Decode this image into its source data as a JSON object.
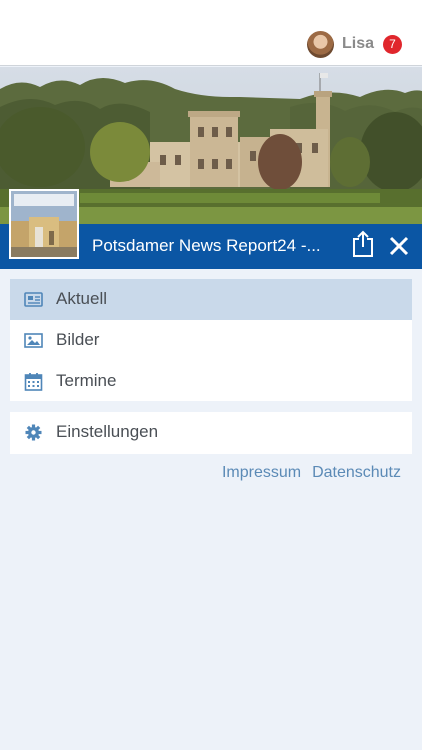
{
  "user": {
    "name": "Lisa",
    "notifications": "7"
  },
  "header": {
    "title": "Potsdamer News Report24 -..."
  },
  "menu": {
    "items": [
      {
        "label": "Aktuell",
        "icon": "newspaper-icon",
        "active": true
      },
      {
        "label": "Bilder",
        "icon": "image-icon",
        "active": false
      },
      {
        "label": "Termine",
        "icon": "calendar-icon",
        "active": false
      }
    ],
    "settings": {
      "label": "Einstellungen",
      "icon": "gear-icon"
    }
  },
  "footer": {
    "impressum": "Impressum",
    "datenschutz": "Datenschutz"
  },
  "colors": {
    "accent": "#0b56a4",
    "active_bg": "#c9d9ea",
    "link": "#5b8ab6",
    "badge": "#e0262c",
    "icon": "#4f86b8"
  }
}
